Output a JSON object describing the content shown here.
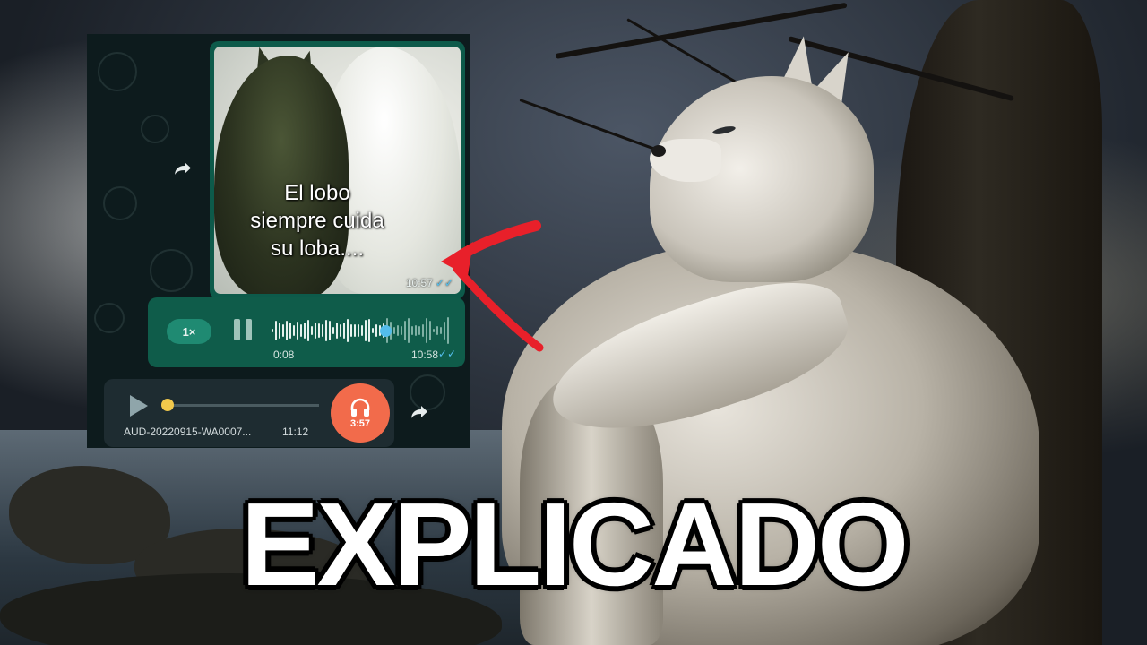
{
  "image_message": {
    "caption": "El lobo\nsiempre cuida\nsu loba....",
    "time": "10:57"
  },
  "voice_message": {
    "speed": "1×",
    "elapsed": "0:08",
    "time": "10:58",
    "progress": 0.64
  },
  "audio_message": {
    "filename": "AUD-20220915-WA0007...",
    "time": "11:12",
    "duration": "3:57",
    "progress": 0.0
  },
  "title": "EXPLICADO",
  "colors": {
    "accent_red": "#e8202a",
    "voice_bubble": "#0f5c4a",
    "read_ticks": "#53bdeb",
    "headphones_badge": "#f26b4b"
  },
  "icons": [
    "forward-icon",
    "pause-icon",
    "play-icon",
    "headphones-icon",
    "double-check-icon"
  ]
}
